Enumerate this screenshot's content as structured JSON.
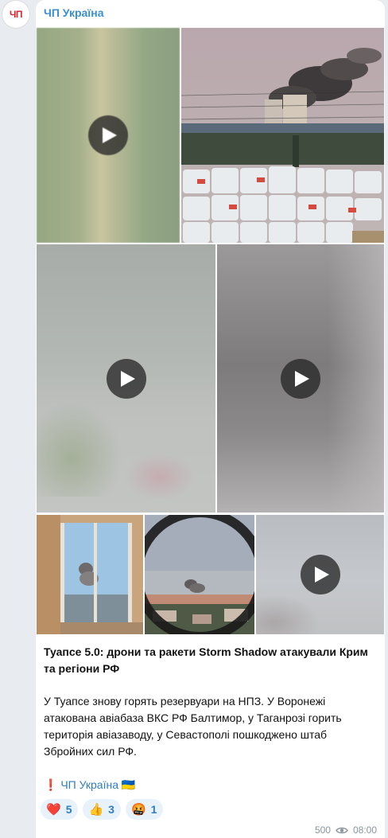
{
  "avatar": {
    "text": "ЧП",
    "color": "#e0242c"
  },
  "channel": {
    "name": "ЧП Україна"
  },
  "media": [
    {
      "type": "video",
      "thumbnail": "blurred-green-frame"
    },
    {
      "type": "photo",
      "thumbnail": "smoke-over-industrial-yard"
    },
    {
      "type": "video",
      "thumbnail": "blurred-sky-frame"
    },
    {
      "type": "video",
      "thumbnail": "blurred-grey-frame"
    },
    {
      "type": "photo",
      "thumbnail": "smoke-through-window"
    },
    {
      "type": "photo",
      "thumbnail": "smoke-over-town"
    },
    {
      "type": "video",
      "thumbnail": "blurred-sky-frame"
    }
  ],
  "post": {
    "title": "Туапсе 5.0: дрони та ракети Storm Shadow атакували Крим та регіони РФ",
    "body": "У Туапсе знову горять резервуари на НПЗ. У Воронежі атакована авіабаза ВКС РФ Балтимор, у Таганрозі горить територія авіазаводу, у Севастополі пошкоджено штаб Збройних сил РФ.",
    "signature_mark": "❗️",
    "signature_link": "ЧП Україна",
    "signature_flag": "🇺🇦"
  },
  "reactions": [
    {
      "emoji": "❤️",
      "count": "5",
      "icon": "heart-icon"
    },
    {
      "emoji": "👍",
      "count": "3",
      "icon": "thumbs-up-icon"
    },
    {
      "emoji": "🤬",
      "count": "1",
      "icon": "angry-face-icon"
    }
  ],
  "meta": {
    "views": "500",
    "time": "08:00",
    "icon": "eye-icon"
  }
}
